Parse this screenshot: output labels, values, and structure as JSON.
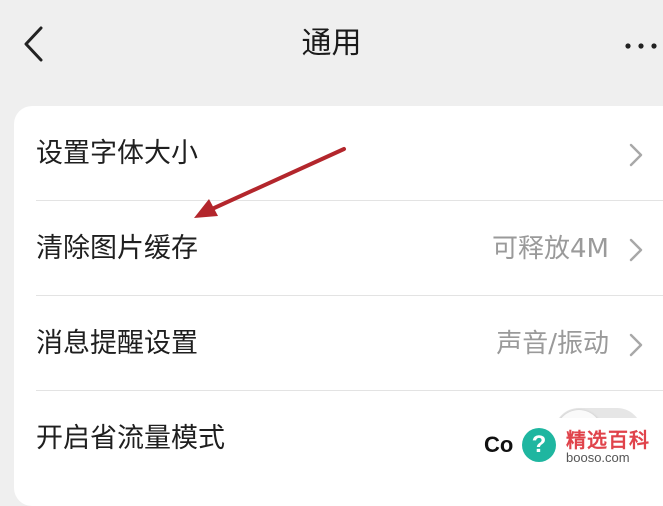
{
  "header": {
    "title": "通用",
    "back_icon": "chevron-left-icon",
    "more_icon": "more-horizontal-icon"
  },
  "settings": {
    "items": [
      {
        "label": "设置字体大小",
        "value": "",
        "icon": "chevron-right-icon"
      },
      {
        "label": "清除图片缓存",
        "value": "可释放4M",
        "icon": "chevron-right-icon"
      },
      {
        "label": "消息提醒设置",
        "value": "声音/振动",
        "icon": "chevron-right-icon"
      },
      {
        "label": "开启省流量模式",
        "toggle_on": false
      }
    ]
  },
  "annotation": {
    "icon": "arrow-icon",
    "color": "#b3262c"
  },
  "watermark": {
    "partial_text": "Co",
    "badge": "?",
    "brand": "精选百科",
    "site": "booso.com"
  }
}
